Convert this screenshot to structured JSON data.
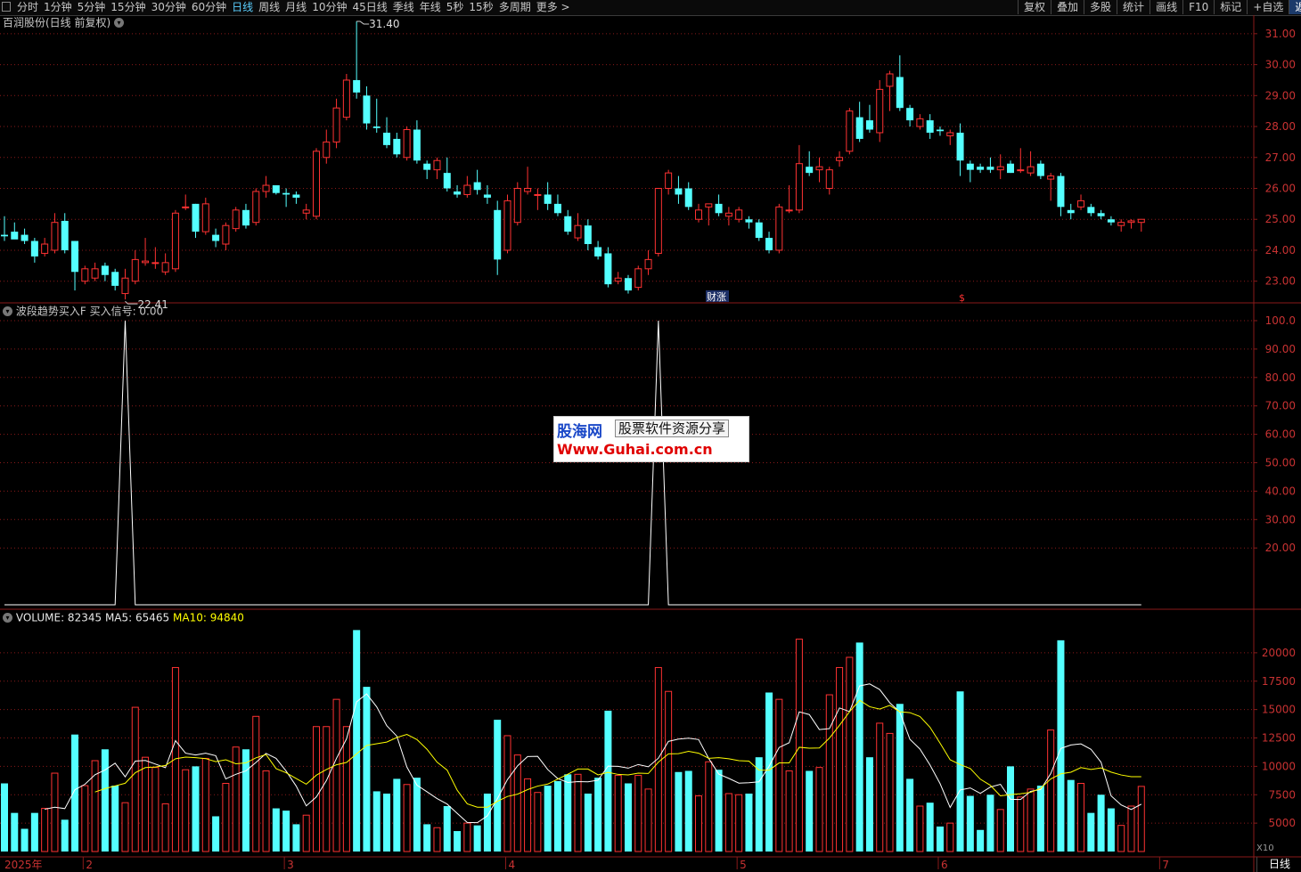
{
  "toolbar": {
    "lock_icon": "lock-icon",
    "periods": [
      "分时",
      "1分钟",
      "5分钟",
      "15分钟",
      "30分钟",
      "60分钟",
      "日线",
      "周线",
      "月线",
      "10分钟",
      "45日线",
      "季线",
      "年线",
      "5秒",
      "15秒",
      "多周期",
      "更多 >"
    ],
    "active_period": "日线",
    "right_buttons": [
      "复权",
      "叠加",
      "多股",
      "统计",
      "画线",
      "F10",
      "标记",
      "+自选",
      "返回"
    ]
  },
  "price_panel": {
    "title": "百润股份(日线 前复权)",
    "high_label": "31.40",
    "low_label": "22.41",
    "event_tag_1": "财涨",
    "event_tag_2": "$",
    "axis_ticks": [
      "31.00",
      "30.00",
      "29.00",
      "28.00",
      "27.00",
      "26.00",
      "25.00",
      "24.00",
      "23.00"
    ]
  },
  "indicator_panel": {
    "title": "波段趋势买入F",
    "value_label": "买入信号: 0.00",
    "axis_ticks": [
      "100.0",
      "90.00",
      "80.00",
      "70.00",
      "60.00",
      "50.00",
      "40.00",
      "30.00",
      "20.00"
    ]
  },
  "volume_panel": {
    "label_volume": "VOLUME: 82345",
    "label_ma5": "MA5: 65465",
    "label_ma10": "MA10: 94840",
    "axis_ticks": [
      "20000",
      "17500",
      "15000",
      "12500",
      "10000",
      "7500",
      "5000"
    ],
    "unit": "X10"
  },
  "date_axis": {
    "labels": [
      "2025年",
      "2",
      "3",
      "4",
      "5",
      "6",
      "7"
    ]
  },
  "footer": {
    "period": "日线"
  },
  "watermark": {
    "logo": "股海网",
    "subtitle": "股票软件资源分享",
    "url": "Www.Guhai.com.cn"
  },
  "colors": {
    "up": "#ff3232",
    "down": "#54ffff",
    "grid": "#8a1a1a",
    "ma5": "#ffffff",
    "ma10": "#ffff00",
    "active": "#5bd0ff"
  },
  "chart_data": [
    {
      "type": "candlestick",
      "title": "百润股份(日线 前复权)",
      "ylim": [
        22.3,
        31.6
      ],
      "annotations": [
        {
          "label": "31.40",
          "type": "high"
        },
        {
          "label": "22.41",
          "type": "low"
        }
      ],
      "series": [
        {
          "o": 24.5,
          "h": 25.1,
          "l": 24.3,
          "c": 24.45,
          "v": 8500
        },
        {
          "o": 24.6,
          "h": 24.9,
          "l": 24.4,
          "c": 24.35,
          "v": 5900
        },
        {
          "o": 24.5,
          "h": 24.7,
          "l": 24.2,
          "c": 24.3,
          "v": 4500
        },
        {
          "o": 24.3,
          "h": 24.4,
          "l": 23.6,
          "c": 23.8,
          "v": 5900
        },
        {
          "o": 23.9,
          "h": 24.4,
          "l": 23.8,
          "c": 24.2,
          "v": 6300
        },
        {
          "o": 24.0,
          "h": 25.2,
          "l": 23.9,
          "c": 24.9,
          "v": 9400
        },
        {
          "o": 24.95,
          "h": 25.2,
          "l": 23.9,
          "c": 24.0,
          "v": 5300
        },
        {
          "o": 24.3,
          "h": 24.3,
          "l": 22.7,
          "c": 23.3,
          "v": 12800
        },
        {
          "o": 23.0,
          "h": 23.5,
          "l": 22.9,
          "c": 23.4,
          "v": 8300
        },
        {
          "o": 23.1,
          "h": 23.6,
          "l": 23.0,
          "c": 23.4,
          "v": 10500
        },
        {
          "o": 23.5,
          "h": 23.6,
          "l": 23.0,
          "c": 23.2,
          "v": 11500
        },
        {
          "o": 23.3,
          "h": 23.4,
          "l": 22.7,
          "c": 22.85,
          "v": 8300
        },
        {
          "o": 22.6,
          "h": 23.4,
          "l": 22.41,
          "c": 23.1,
          "v": 6800
        },
        {
          "o": 23.0,
          "h": 24.0,
          "l": 22.9,
          "c": 23.7,
          "v": 15200
        },
        {
          "o": 23.6,
          "h": 24.4,
          "l": 23.5,
          "c": 23.65,
          "v": 10800
        },
        {
          "o": 23.6,
          "h": 24.1,
          "l": 23.4,
          "c": 23.6,
          "v": 9900
        },
        {
          "o": 23.3,
          "h": 23.9,
          "l": 23.2,
          "c": 23.6,
          "v": 6700
        },
        {
          "o": 23.4,
          "h": 25.3,
          "l": 23.3,
          "c": 25.2,
          "v": 18700
        },
        {
          "o": 25.4,
          "h": 25.8,
          "l": 25.3,
          "c": 25.4,
          "v": 9700
        },
        {
          "o": 25.5,
          "h": 25.5,
          "l": 24.4,
          "c": 24.6,
          "v": 10000
        },
        {
          "o": 24.6,
          "h": 25.7,
          "l": 24.5,
          "c": 25.5,
          "v": 10700
        },
        {
          "o": 24.5,
          "h": 24.7,
          "l": 24.1,
          "c": 24.3,
          "v": 5600
        },
        {
          "o": 24.2,
          "h": 24.9,
          "l": 24.0,
          "c": 24.8,
          "v": 8500
        },
        {
          "o": 24.7,
          "h": 25.4,
          "l": 24.6,
          "c": 25.3,
          "v": 11700
        },
        {
          "o": 25.3,
          "h": 25.5,
          "l": 24.7,
          "c": 24.8,
          "v": 11500
        },
        {
          "o": 24.9,
          "h": 26.0,
          "l": 24.8,
          "c": 25.9,
          "v": 14400
        },
        {
          "o": 25.9,
          "h": 26.4,
          "l": 25.7,
          "c": 26.1,
          "v": 9600
        },
        {
          "o": 26.1,
          "h": 26.1,
          "l": 25.8,
          "c": 25.85,
          "v": 6300
        },
        {
          "o": 25.85,
          "h": 26.0,
          "l": 25.4,
          "c": 25.8,
          "v": 6100
        },
        {
          "o": 25.8,
          "h": 25.9,
          "l": 25.5,
          "c": 25.7,
          "v": 4900
        },
        {
          "o": 25.2,
          "h": 25.5,
          "l": 25.0,
          "c": 25.3,
          "v": 5700
        },
        {
          "o": 25.1,
          "h": 27.3,
          "l": 25.0,
          "c": 27.2,
          "v": 13500
        },
        {
          "o": 27.0,
          "h": 27.9,
          "l": 26.8,
          "c": 27.5,
          "v": 13500
        },
        {
          "o": 27.5,
          "h": 28.9,
          "l": 27.3,
          "c": 28.6,
          "v": 15900
        },
        {
          "o": 28.3,
          "h": 29.7,
          "l": 28.2,
          "c": 29.5,
          "v": 13500
        },
        {
          "o": 29.5,
          "h": 31.4,
          "l": 28.9,
          "c": 29.1,
          "v": 22000
        },
        {
          "o": 29.0,
          "h": 29.3,
          "l": 27.9,
          "c": 28.1,
          "v": 17000
        },
        {
          "o": 28.0,
          "h": 28.9,
          "l": 27.8,
          "c": 27.95,
          "v": 7800
        },
        {
          "o": 27.8,
          "h": 28.3,
          "l": 27.3,
          "c": 27.4,
          "v": 7600
        },
        {
          "o": 27.6,
          "h": 27.8,
          "l": 27.0,
          "c": 27.1,
          "v": 8900
        },
        {
          "o": 27.0,
          "h": 28.0,
          "l": 26.9,
          "c": 27.9,
          "v": 8400
        },
        {
          "o": 27.9,
          "h": 28.2,
          "l": 26.8,
          "c": 26.9,
          "v": 9000
        },
        {
          "o": 26.8,
          "h": 26.9,
          "l": 26.3,
          "c": 26.6,
          "v": 4900
        },
        {
          "o": 26.6,
          "h": 27.0,
          "l": 26.3,
          "c": 26.9,
          "v": 4600
        },
        {
          "o": 26.5,
          "h": 27.0,
          "l": 25.9,
          "c": 26.0,
          "v": 6500
        },
        {
          "o": 25.9,
          "h": 26.1,
          "l": 25.7,
          "c": 25.8,
          "v": 4300
        },
        {
          "o": 25.8,
          "h": 26.4,
          "l": 25.7,
          "c": 26.1,
          "v": 5000
        },
        {
          "o": 26.2,
          "h": 26.6,
          "l": 25.8,
          "c": 25.95,
          "v": 4800
        },
        {
          "o": 25.8,
          "h": 26.1,
          "l": 25.5,
          "c": 25.7,
          "v": 7600
        },
        {
          "o": 25.3,
          "h": 25.6,
          "l": 23.2,
          "c": 23.7,
          "v": 14100
        },
        {
          "o": 24.0,
          "h": 25.8,
          "l": 23.9,
          "c": 25.6,
          "v": 12700
        },
        {
          "o": 24.9,
          "h": 26.2,
          "l": 24.8,
          "c": 26.0,
          "v": 11000
        },
        {
          "o": 25.9,
          "h": 26.7,
          "l": 25.8,
          "c": 26.0,
          "v": 8900
        },
        {
          "o": 25.8,
          "h": 26.0,
          "l": 25.3,
          "c": 25.8,
          "v": 7700
        },
        {
          "o": 25.8,
          "h": 26.2,
          "l": 25.3,
          "c": 25.5,
          "v": 8300
        },
        {
          "o": 25.5,
          "h": 25.8,
          "l": 25.1,
          "c": 25.2,
          "v": 8700
        },
        {
          "o": 25.1,
          "h": 25.3,
          "l": 24.5,
          "c": 24.6,
          "v": 9300
        },
        {
          "o": 24.4,
          "h": 25.2,
          "l": 24.3,
          "c": 24.8,
          "v": 9300
        },
        {
          "o": 24.8,
          "h": 25.0,
          "l": 24.0,
          "c": 24.2,
          "v": 7600
        },
        {
          "o": 24.1,
          "h": 24.3,
          "l": 23.7,
          "c": 23.8,
          "v": 9000
        },
        {
          "o": 23.9,
          "h": 24.1,
          "l": 22.8,
          "c": 22.9,
          "v": 14900
        },
        {
          "o": 23.0,
          "h": 23.3,
          "l": 22.9,
          "c": 23.1,
          "v": 9200
        },
        {
          "o": 23.1,
          "h": 23.2,
          "l": 22.6,
          "c": 22.7,
          "v": 8500
        },
        {
          "o": 22.8,
          "h": 23.5,
          "l": 22.7,
          "c": 23.4,
          "v": 9200
        },
        {
          "o": 23.4,
          "h": 24.0,
          "l": 23.2,
          "c": 23.7,
          "v": 8000
        },
        {
          "o": 23.9,
          "h": 26.0,
          "l": 23.8,
          "c": 26.0,
          "v": 18700
        },
        {
          "o": 26.0,
          "h": 26.6,
          "l": 25.8,
          "c": 26.5,
          "v": 16600
        },
        {
          "o": 26.0,
          "h": 26.4,
          "l": 25.5,
          "c": 25.8,
          "v": 9500
        },
        {
          "o": 26.0,
          "h": 26.2,
          "l": 25.3,
          "c": 25.4,
          "v": 9600
        },
        {
          "o": 25.0,
          "h": 25.5,
          "l": 24.9,
          "c": 25.3,
          "v": 7400
        },
        {
          "o": 25.4,
          "h": 25.5,
          "l": 24.8,
          "c": 25.5,
          "v": 10400
        },
        {
          "o": 25.5,
          "h": 25.8,
          "l": 25.1,
          "c": 25.2,
          "v": 9700
        },
        {
          "o": 25.1,
          "h": 25.4,
          "l": 24.8,
          "c": 25.2,
          "v": 7600
        },
        {
          "o": 25.0,
          "h": 25.4,
          "l": 24.9,
          "c": 25.3,
          "v": 7500
        },
        {
          "o": 25.0,
          "h": 25.1,
          "l": 24.7,
          "c": 24.9,
          "v": 7600
        },
        {
          "o": 24.9,
          "h": 25.0,
          "l": 24.3,
          "c": 24.4,
          "v": 10800
        },
        {
          "o": 24.4,
          "h": 24.6,
          "l": 23.9,
          "c": 24.0,
          "v": 16500
        },
        {
          "o": 24.0,
          "h": 25.5,
          "l": 23.9,
          "c": 25.4,
          "v": 15900
        },
        {
          "o": 25.3,
          "h": 26.1,
          "l": 25.2,
          "c": 25.3,
          "v": 9600
        },
        {
          "o": 25.3,
          "h": 27.4,
          "l": 25.2,
          "c": 26.8,
          "v": 21200
        },
        {
          "o": 26.7,
          "h": 27.2,
          "l": 26.4,
          "c": 26.5,
          "v": 9600
        },
        {
          "o": 26.6,
          "h": 27.0,
          "l": 26.2,
          "c": 26.7,
          "v": 9900
        },
        {
          "o": 26.0,
          "h": 26.7,
          "l": 25.8,
          "c": 26.6,
          "v": 16300
        },
        {
          "o": 26.9,
          "h": 27.2,
          "l": 26.7,
          "c": 27.0,
          "v": 18700
        },
        {
          "o": 27.2,
          "h": 28.6,
          "l": 27.1,
          "c": 28.5,
          "v": 19600
        },
        {
          "o": 28.3,
          "h": 28.8,
          "l": 27.5,
          "c": 27.6,
          "v": 20900
        },
        {
          "o": 28.2,
          "h": 28.7,
          "l": 27.8,
          "c": 27.9,
          "v": 10800
        },
        {
          "o": 27.8,
          "h": 29.5,
          "l": 27.5,
          "c": 29.2,
          "v": 13800
        },
        {
          "o": 29.3,
          "h": 29.8,
          "l": 28.5,
          "c": 29.7,
          "v": 12900
        },
        {
          "o": 29.6,
          "h": 30.3,
          "l": 28.5,
          "c": 28.6,
          "v": 15500
        },
        {
          "o": 28.6,
          "h": 28.7,
          "l": 28.0,
          "c": 28.2,
          "v": 8900
        },
        {
          "o": 28.0,
          "h": 28.4,
          "l": 27.9,
          "c": 28.25,
          "v": 6500
        },
        {
          "o": 28.2,
          "h": 28.4,
          "l": 27.6,
          "c": 27.8,
          "v": 6800
        },
        {
          "o": 27.9,
          "h": 28.0,
          "l": 27.7,
          "c": 27.85,
          "v": 4700
        },
        {
          "o": 27.7,
          "h": 27.9,
          "l": 27.4,
          "c": 27.8,
          "v": 5000
        },
        {
          "o": 27.8,
          "h": 28.1,
          "l": 26.4,
          "c": 26.9,
          "v": 16600
        },
        {
          "o": 26.8,
          "h": 26.9,
          "l": 26.2,
          "c": 26.6,
          "v": 7400
        },
        {
          "o": 26.7,
          "h": 26.8,
          "l": 26.5,
          "c": 26.6,
          "v": 4400
        },
        {
          "o": 26.7,
          "h": 27.0,
          "l": 26.5,
          "c": 26.6,
          "v": 7500
        },
        {
          "o": 26.6,
          "h": 27.1,
          "l": 26.3,
          "c": 26.7,
          "v": 6200
        },
        {
          "o": 26.8,
          "h": 26.9,
          "l": 26.5,
          "c": 26.5,
          "v": 10000
        },
        {
          "o": 26.6,
          "h": 27.3,
          "l": 26.5,
          "c": 26.6,
          "v": 7300
        },
        {
          "o": 26.5,
          "h": 27.2,
          "l": 26.4,
          "c": 26.7,
          "v": 8000
        },
        {
          "o": 26.8,
          "h": 26.9,
          "l": 26.3,
          "c": 26.4,
          "v": 8300
        },
        {
          "o": 26.3,
          "h": 26.5,
          "l": 25.6,
          "c": 26.4,
          "v": 13200
        },
        {
          "o": 26.4,
          "h": 26.5,
          "l": 25.1,
          "c": 25.4,
          "v": 21100
        },
        {
          "o": 25.3,
          "h": 25.5,
          "l": 25.0,
          "c": 25.2,
          "v": 8800
        },
        {
          "o": 25.4,
          "h": 25.8,
          "l": 25.3,
          "c": 25.6,
          "v": 8500
        },
        {
          "o": 25.4,
          "h": 25.5,
          "l": 25.1,
          "c": 25.2,
          "v": 5900
        },
        {
          "o": 25.2,
          "h": 25.3,
          "l": 25.0,
          "c": 25.1,
          "v": 7500
        },
        {
          "o": 25.0,
          "h": 25.1,
          "l": 24.8,
          "c": 24.9,
          "v": 6300
        },
        {
          "o": 24.8,
          "h": 25.0,
          "l": 24.6,
          "c": 24.9,
          "v": 4800
        },
        {
          "o": 24.9,
          "h": 25.0,
          "l": 24.7,
          "c": 24.95,
          "v": 6500
        },
        {
          "o": 24.9,
          "h": 25.0,
          "l": 24.6,
          "c": 25.0,
          "v": 8234
        }
      ]
    },
    {
      "type": "line",
      "title": "波段趋势买入F",
      "ylim": [
        0,
        100
      ],
      "spikes": [
        {
          "index": 12,
          "value": 100
        },
        {
          "index": 65,
          "value": 100
        }
      ]
    },
    {
      "type": "bar",
      "title": "VOLUME",
      "ylim": [
        2500,
        22500
      ],
      "ma": [
        {
          "name": "MA5",
          "period": 5
        },
        {
          "name": "MA10",
          "period": 10
        }
      ],
      "note": "bar values are the v field of each candle above"
    }
  ]
}
